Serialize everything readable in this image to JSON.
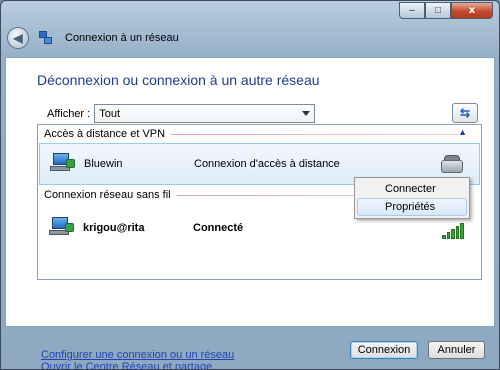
{
  "window": {
    "title": "Connexion à un réseau",
    "controls": {
      "minimize": "–",
      "maximize": "□",
      "close": "x"
    }
  },
  "nav": {
    "back_icon": "back-arrow-icon"
  },
  "main": {
    "heading": "Déconnexion ou connexion à un autre réseau",
    "filter": {
      "label": "Afficher :",
      "value": "Tout"
    },
    "refresh_icon": "refresh-arrows-icon"
  },
  "groups": [
    {
      "title": "Accès à distance et VPN",
      "connections": [
        {
          "name": "Bluewin",
          "status": "Connexion d'accès à distance",
          "icon": "dialup-phone-icon"
        }
      ]
    },
    {
      "title": "Connexion réseau sans fil",
      "connections": [
        {
          "name": "krigou@rita",
          "status": "Connecté",
          "icon": "signal-strength-icon"
        }
      ]
    }
  ],
  "context_menu": {
    "items": [
      "Connecter",
      "Propriétés"
    ]
  },
  "links": [
    "Configurer une connexion ou un réseau",
    "Ouvrir le Centre Réseau et partage"
  ],
  "buttons": {
    "connect": "Connexion",
    "cancel": "Annuler"
  },
  "colors": {
    "heading": "#1e3e8f",
    "link": "#1e44b0",
    "selection": "#dcecf8"
  }
}
